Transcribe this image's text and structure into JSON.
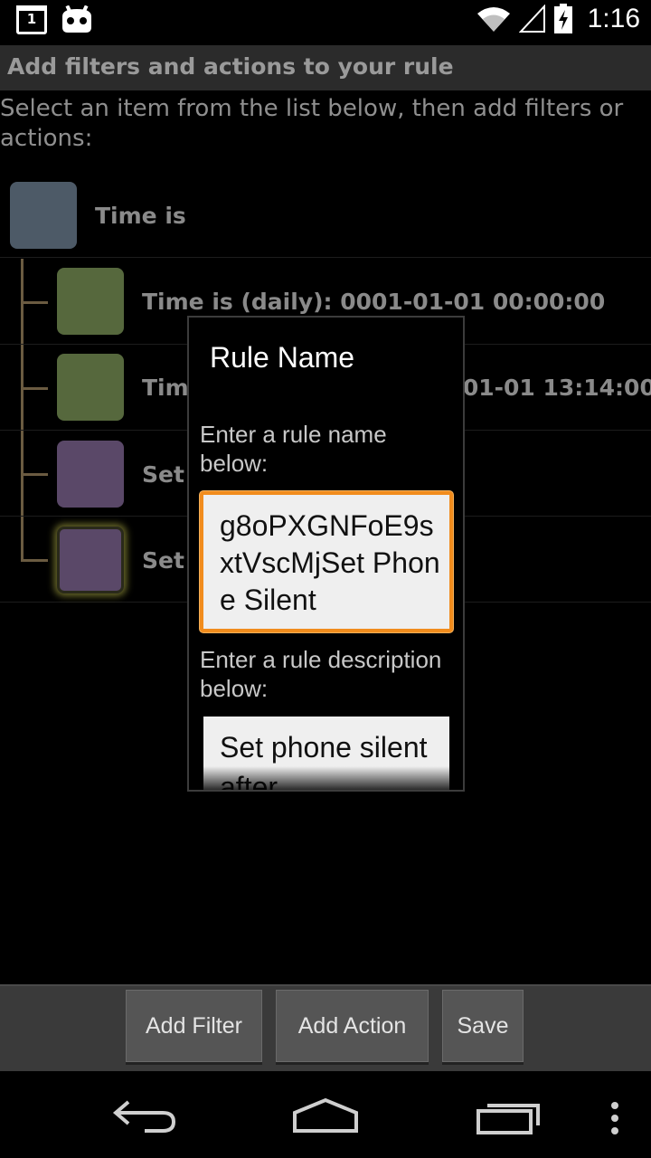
{
  "status_bar": {
    "calendar_day": "1",
    "time": "1:16",
    "icons": [
      "calendar-notification-icon",
      "android-robot-icon",
      "wifi-icon",
      "cell-signal-icon",
      "battery-charging-icon"
    ]
  },
  "header": {
    "title": "Add filters and actions to your rule"
  },
  "instructions": "Select an item from the list below, then add filters or actions:",
  "tree": {
    "items": [
      {
        "label": "Time is",
        "color": "#4d5a67"
      },
      {
        "label": "Time is (daily): 0001-01-01 00:00:00",
        "color": "#56683d"
      },
      {
        "label": "Time is not (daily): 0001-01-01 13:14:00",
        "color": "#56683d"
      },
      {
        "label": "Set Phone Silent",
        "color": "#5a4868"
      },
      {
        "label": "Set",
        "color": "#5a4868"
      }
    ]
  },
  "dialog": {
    "title": "Rule Name",
    "name_label": "Enter a rule name below:",
    "name_value": "g8oPXGNFoE9sxtVscMjSet Phone Silent",
    "description_label": "Enter a rule description below:",
    "description_value": "Set phone silent after"
  },
  "buttons": {
    "add_filter": "Add Filter",
    "add_action": "Add Action",
    "save": "Save"
  },
  "colors": {
    "focus_accent": "#f18c1d",
    "tree_connector": "#6b5b41"
  }
}
